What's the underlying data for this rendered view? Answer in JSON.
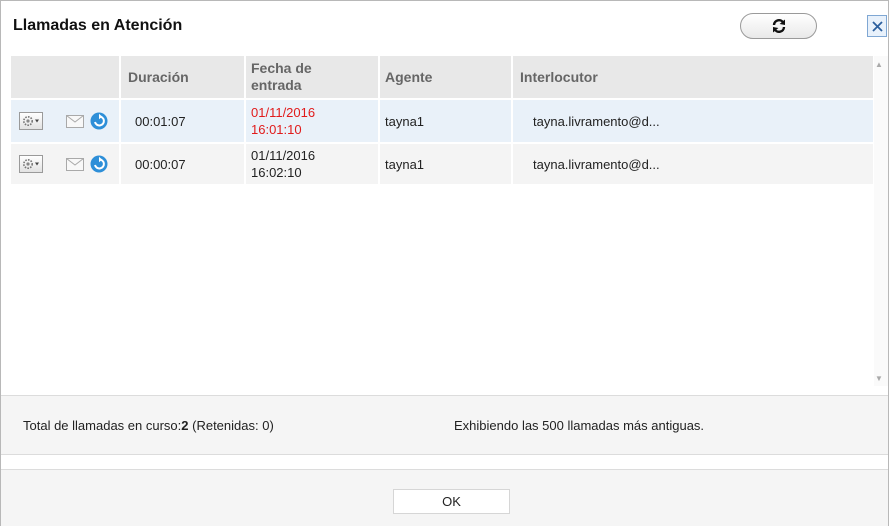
{
  "dialog": {
    "title": "Llamadas en Atención"
  },
  "icons": {
    "refresh": "refresh-icon",
    "close": "close-icon",
    "gear": "gear-icon",
    "mail": "mail-icon",
    "transfer": "transfer-icon"
  },
  "table": {
    "headers": {
      "duration": "Duración",
      "entry_date_line1": "Fecha de",
      "entry_date_line2": "entrada",
      "agent": "Agente",
      "interlocutor": "Interlocutor"
    },
    "rows": [
      {
        "duration": "00:01:07",
        "date": "01/11/2016",
        "time": "16:01:10",
        "agent": "tayna1",
        "interlocutor": "tayna.livramento@d..."
      },
      {
        "duration": "00:00:07",
        "date": "01/11/2016",
        "time": "16:02:10",
        "agent": "tayna1",
        "interlocutor": "tayna.livramento@d..."
      }
    ]
  },
  "status": {
    "total_label": "Total de llamadas en curso:",
    "total_value": "2",
    "held": "(Retenidas: 0)",
    "showing": "Exhibiendo las 500 llamadas más antiguas."
  },
  "footer": {
    "ok_label": "OK"
  },
  "colors": {
    "highlight_row": "#e9f1f9",
    "alert_text": "#e11b1b",
    "header_bg": "#e8e8e8"
  }
}
